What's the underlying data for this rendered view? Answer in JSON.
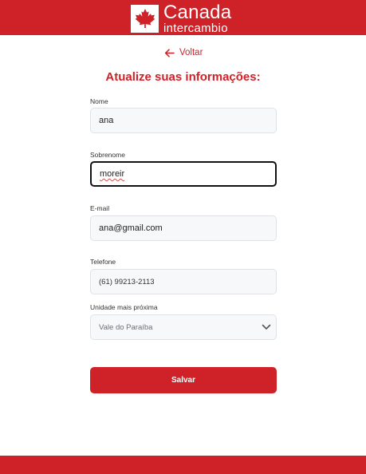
{
  "brand": {
    "title": "Canada",
    "subtitle": "intercambio",
    "primary_color": "#cf2228",
    "logo_icon": "maple-leaf-icon"
  },
  "nav": {
    "back_label": "Voltar",
    "back_icon": "arrow-left-icon"
  },
  "form": {
    "title": "Atualize suas informações:",
    "nome": {
      "label": "Nome",
      "value": "ana"
    },
    "sobrenome": {
      "label": "Sobrenome",
      "value": "moreir"
    },
    "email": {
      "label": "E-mail",
      "value": "ana@gmail.com"
    },
    "telefone": {
      "label": "Telefone",
      "value": "(61) 99213-2113"
    },
    "unidade": {
      "label": "Unidade mais próxima",
      "value": "Vale do Paraíba",
      "icon": "chevron-down-icon"
    },
    "submit_label": "Salvar"
  }
}
